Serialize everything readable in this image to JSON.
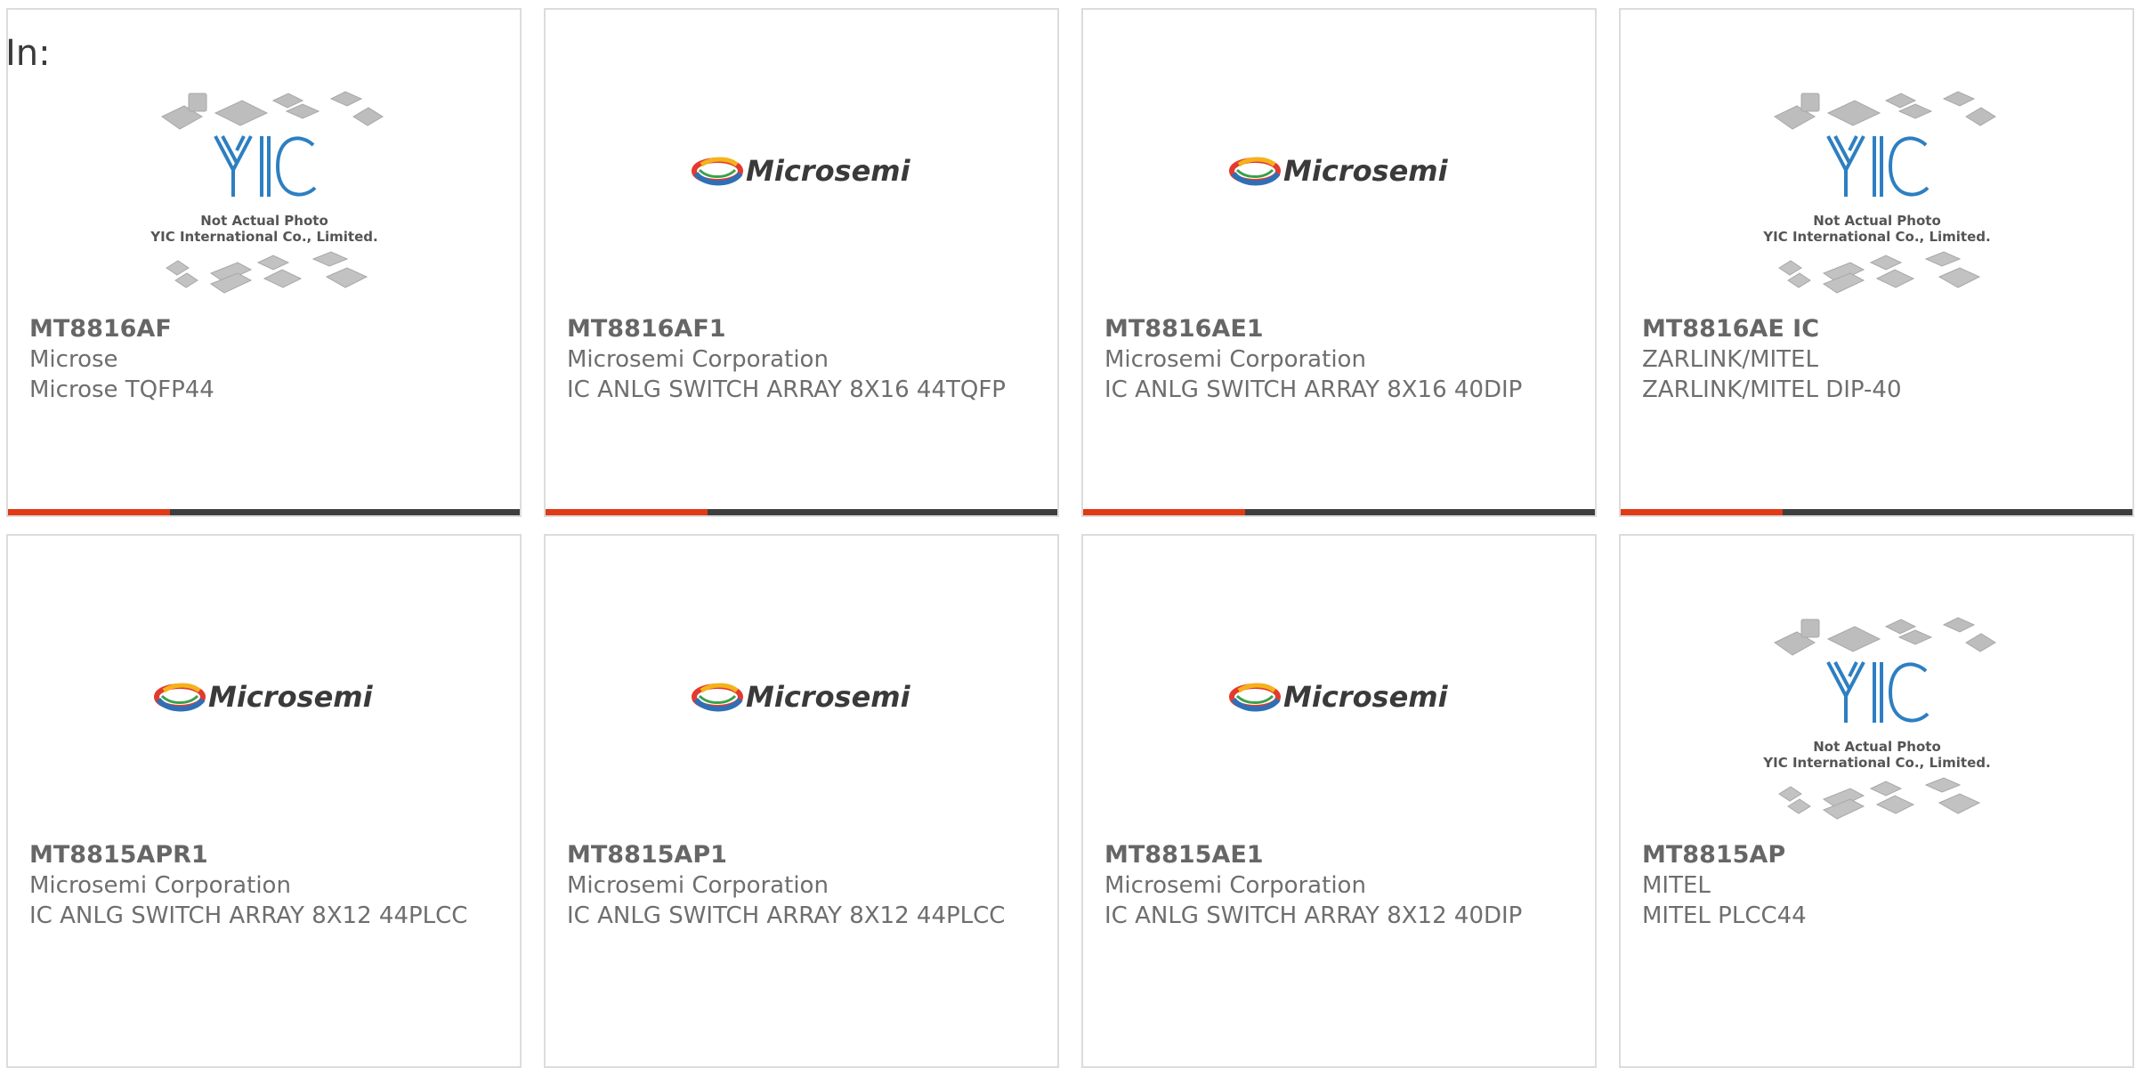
{
  "page": {
    "in_label": "In:"
  },
  "colors": {
    "accent_bar": "#e03a16",
    "dark_bar": "#3e3e3e",
    "border": "#dcdcdc",
    "text": "#6e6e6e"
  },
  "products": [
    {
      "part_number": "MT8816AF",
      "manufacturer": "Microse",
      "description": "Microse TQFP44",
      "image": "yic-not-actual-photo",
      "image_caption_1": "Not Actual Photo",
      "image_caption_2": "YIC International Co., Limited.",
      "logo_text": "YIC"
    },
    {
      "part_number": "MT8816AF1",
      "manufacturer": "Microsemi Corporation",
      "description": "IC ANLG SWITCH ARRAY 8X16 44TQFP",
      "image": "microsemi-logo",
      "logo_text": "Microsemi"
    },
    {
      "part_number": "MT8816AE1",
      "manufacturer": "Microsemi Corporation",
      "description": "IC ANLG SWITCH ARRAY 8X16 40DIP",
      "image": "microsemi-logo",
      "logo_text": "Microsemi"
    },
    {
      "part_number": "MT8816AE IC",
      "manufacturer": "ZARLINK/MITEL",
      "description": "ZARLINK/MITEL DIP-40",
      "image": "yic-not-actual-photo",
      "image_caption_1": "Not Actual Photo",
      "image_caption_2": "YIC International Co., Limited.",
      "logo_text": "YIC"
    },
    {
      "part_number": "MT8815APR1",
      "manufacturer": "Microsemi Corporation",
      "description": "IC ANLG SWITCH ARRAY 8X12 44PLCC",
      "image": "microsemi-logo",
      "logo_text": "Microsemi"
    },
    {
      "part_number": "MT8815AP1",
      "manufacturer": "Microsemi Corporation",
      "description": "IC ANLG SWITCH ARRAY 8X12 44PLCC",
      "image": "microsemi-logo",
      "logo_text": "Microsemi"
    },
    {
      "part_number": "MT8815AE1",
      "manufacturer": "Microsemi Corporation",
      "description": "IC ANLG SWITCH ARRAY 8X12 40DIP",
      "image": "microsemi-logo",
      "logo_text": "Microsemi"
    },
    {
      "part_number": "MT8815AP",
      "manufacturer": "MITEL",
      "description": "MITEL PLCC44",
      "image": "yic-not-actual-photo",
      "image_caption_1": "Not Actual Photo",
      "image_caption_2": "YIC International Co., Limited.",
      "logo_text": "YIC"
    }
  ]
}
